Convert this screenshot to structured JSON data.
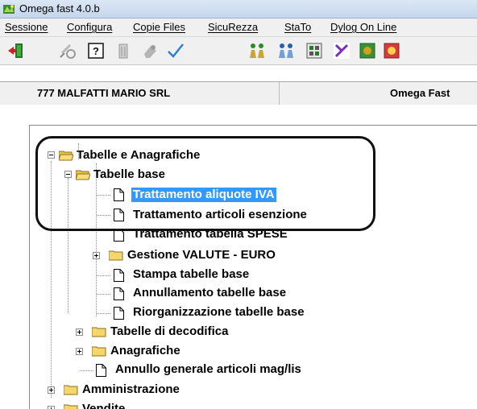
{
  "window": {
    "title": "Omega fast  4.0.b"
  },
  "menu": {
    "items": [
      {
        "label": "Sessione"
      },
      {
        "label": "Configura"
      },
      {
        "label": "Copie Files"
      },
      {
        "label": "SicuRezza"
      },
      {
        "label": "StaTo"
      },
      {
        "label": "Dylog On Line"
      }
    ]
  },
  "toolbar": {
    "buttons": [
      {
        "icon": "exit-door-icon"
      },
      {
        "icon": "satellite-icon"
      },
      {
        "icon": "help-icon"
      },
      {
        "icon": "trash-icon"
      },
      {
        "icon": "eraser-icon"
      },
      {
        "icon": "checkmark-icon"
      },
      {
        "icon": "users-icon"
      },
      {
        "icon": "user-group-icon"
      },
      {
        "icon": "calculator-icon"
      },
      {
        "icon": "tools-icon"
      },
      {
        "icon": "money-icon"
      },
      {
        "icon": "money-red-icon"
      }
    ]
  },
  "infobar": {
    "company": "777 MALFATTI MARIO SRL",
    "product": "Omega Fast"
  },
  "tree": {
    "nodes": [
      {
        "label": "Tabelle e Anagrafiche",
        "type": "folder-open",
        "expander": "minus",
        "level": 0
      },
      {
        "label": "Tabelle base",
        "type": "folder-open",
        "expander": "minus",
        "level": 1
      },
      {
        "label": "Trattamento aliquote IVA",
        "type": "doc",
        "level": 2,
        "selected": true
      },
      {
        "label": "Trattamento articoli esenzione",
        "type": "doc",
        "level": 2
      },
      {
        "label": "Trattamento tabella SPESE",
        "type": "doc",
        "level": 2
      },
      {
        "label": "Gestione  VALUTE - EURO",
        "type": "folder",
        "expander": "plus",
        "level": 2
      },
      {
        "label": "Stampa tabelle base",
        "type": "doc",
        "level": 2
      },
      {
        "label": "Annullamento tabelle base",
        "type": "doc",
        "level": 2
      },
      {
        "label": "Riorganizzazione tabelle base",
        "type": "doc",
        "level": 2
      },
      {
        "label": "Tabelle di decodifica",
        "type": "folder",
        "expander": "plus",
        "level": 1
      },
      {
        "label": "Anagrafiche",
        "type": "folder",
        "expander": "plus",
        "level": 1
      },
      {
        "label": "Annullo generale articoli mag/lis",
        "type": "doc",
        "level": 1
      },
      {
        "label": "Amministrazione",
        "type": "folder",
        "expander": "plus",
        "level": 0
      },
      {
        "label": "Vendite",
        "type": "folder",
        "expander": "plus",
        "level": 0
      }
    ]
  },
  "colors": {
    "selection": "#3399ff",
    "folder": "#f5d66b",
    "annotation": "#111111"
  }
}
